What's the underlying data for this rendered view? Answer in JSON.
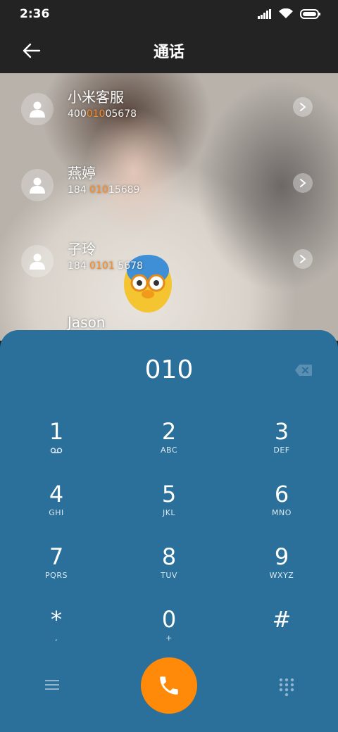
{
  "status_bar": {
    "time": "2:36"
  },
  "app_bar": {
    "title": "通话"
  },
  "contacts": [
    {
      "name": "小米客服",
      "number_parts": [
        "400",
        "010",
        "05678"
      ]
    },
    {
      "name": "燕婷",
      "number_parts": [
        "184 ",
        "010",
        "15689"
      ]
    },
    {
      "name": "子玲",
      "number_parts": [
        "184 ",
        "0101",
        " 5678"
      ]
    },
    {
      "name": "Jason"
    }
  ],
  "dialer": {
    "entered_digits": "010",
    "keys": [
      {
        "digit": "1",
        "sub": ""
      },
      {
        "digit": "2",
        "sub": "ABC"
      },
      {
        "digit": "3",
        "sub": "DEF"
      },
      {
        "digit": "4",
        "sub": "GHI"
      },
      {
        "digit": "5",
        "sub": "JKL"
      },
      {
        "digit": "6",
        "sub": "MNO"
      },
      {
        "digit": "7",
        "sub": "PQRS"
      },
      {
        "digit": "8",
        "sub": "TUV"
      },
      {
        "digit": "9",
        "sub": "WXYZ"
      },
      {
        "digit": "*",
        "sub": ","
      },
      {
        "digit": "0",
        "sub": "+"
      },
      {
        "digit": "#",
        "sub": ""
      }
    ]
  },
  "colors": {
    "dialpad_bg": "#2a709b",
    "call_button": "#ff8a0a",
    "match_highlight": "#ff8a1e",
    "bar_bg": "#232323"
  },
  "icons": {
    "status": [
      "signal-icon",
      "wifi-icon",
      "battery-icon"
    ],
    "back": "back-arrow-icon",
    "avatar": "person-icon",
    "chevron": "chevron-right-icon",
    "backspace": "backspace-icon",
    "voicemail": "voicemail-icon",
    "call": "phone-icon",
    "menu": "menu-icon",
    "dialpad": "dialpad-icon"
  }
}
